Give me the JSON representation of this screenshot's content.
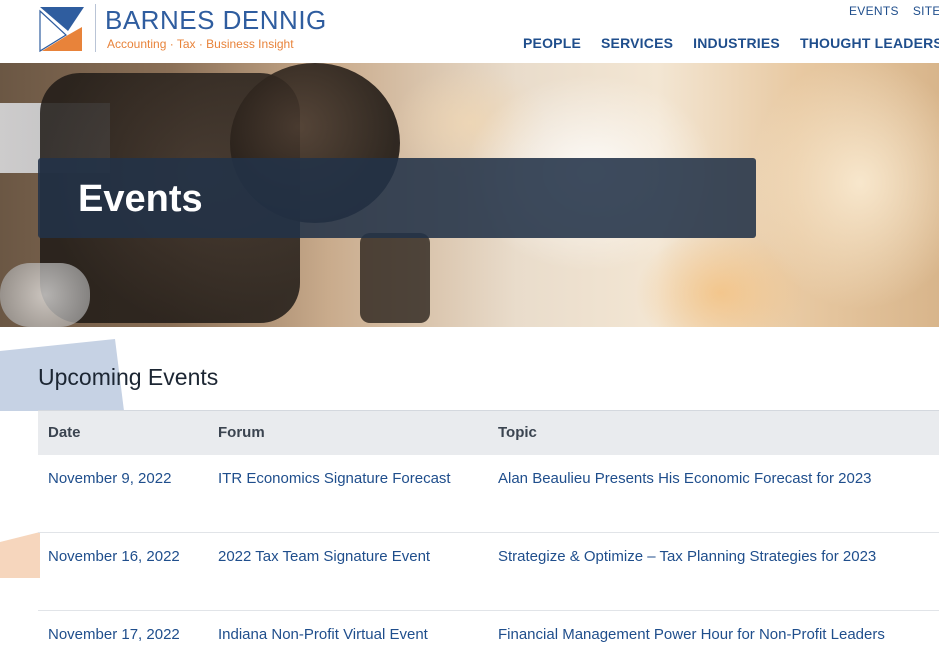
{
  "header": {
    "brand_name": "BARNES DENNIG",
    "tagline": "Accounting  ·  Tax  ·  Business Insight",
    "utility_nav": [
      "EVENTS",
      "SITE S"
    ],
    "main_nav": [
      "PEOPLE",
      "SERVICES",
      "INDUSTRIES",
      "THOUGHT LEADERSHIP"
    ]
  },
  "hero": {
    "title": "Events"
  },
  "section": {
    "title": "Upcoming Events"
  },
  "table": {
    "headers": [
      "Date",
      "Forum",
      "Topic"
    ],
    "rows": [
      [
        "November 9, 2022",
        "ITR Economics Signature Forecast",
        "Alan Beaulieu Presents His Economic Forecast for 2023"
      ],
      [
        "November 16, 2022",
        "2022 Tax Team Signature Event",
        "Strategize & Optimize – Tax Planning Strategies for 2023"
      ],
      [
        "November 17, 2022",
        "Indiana Non-Profit Virtual Event",
        "Financial Management Power Hour for Non-Profit Leaders"
      ]
    ]
  },
  "colors": {
    "brand_blue": "#2f5d9f",
    "brand_orange": "#e8833a",
    "nav_blue": "#1f4e8c",
    "banner": "#223248"
  }
}
